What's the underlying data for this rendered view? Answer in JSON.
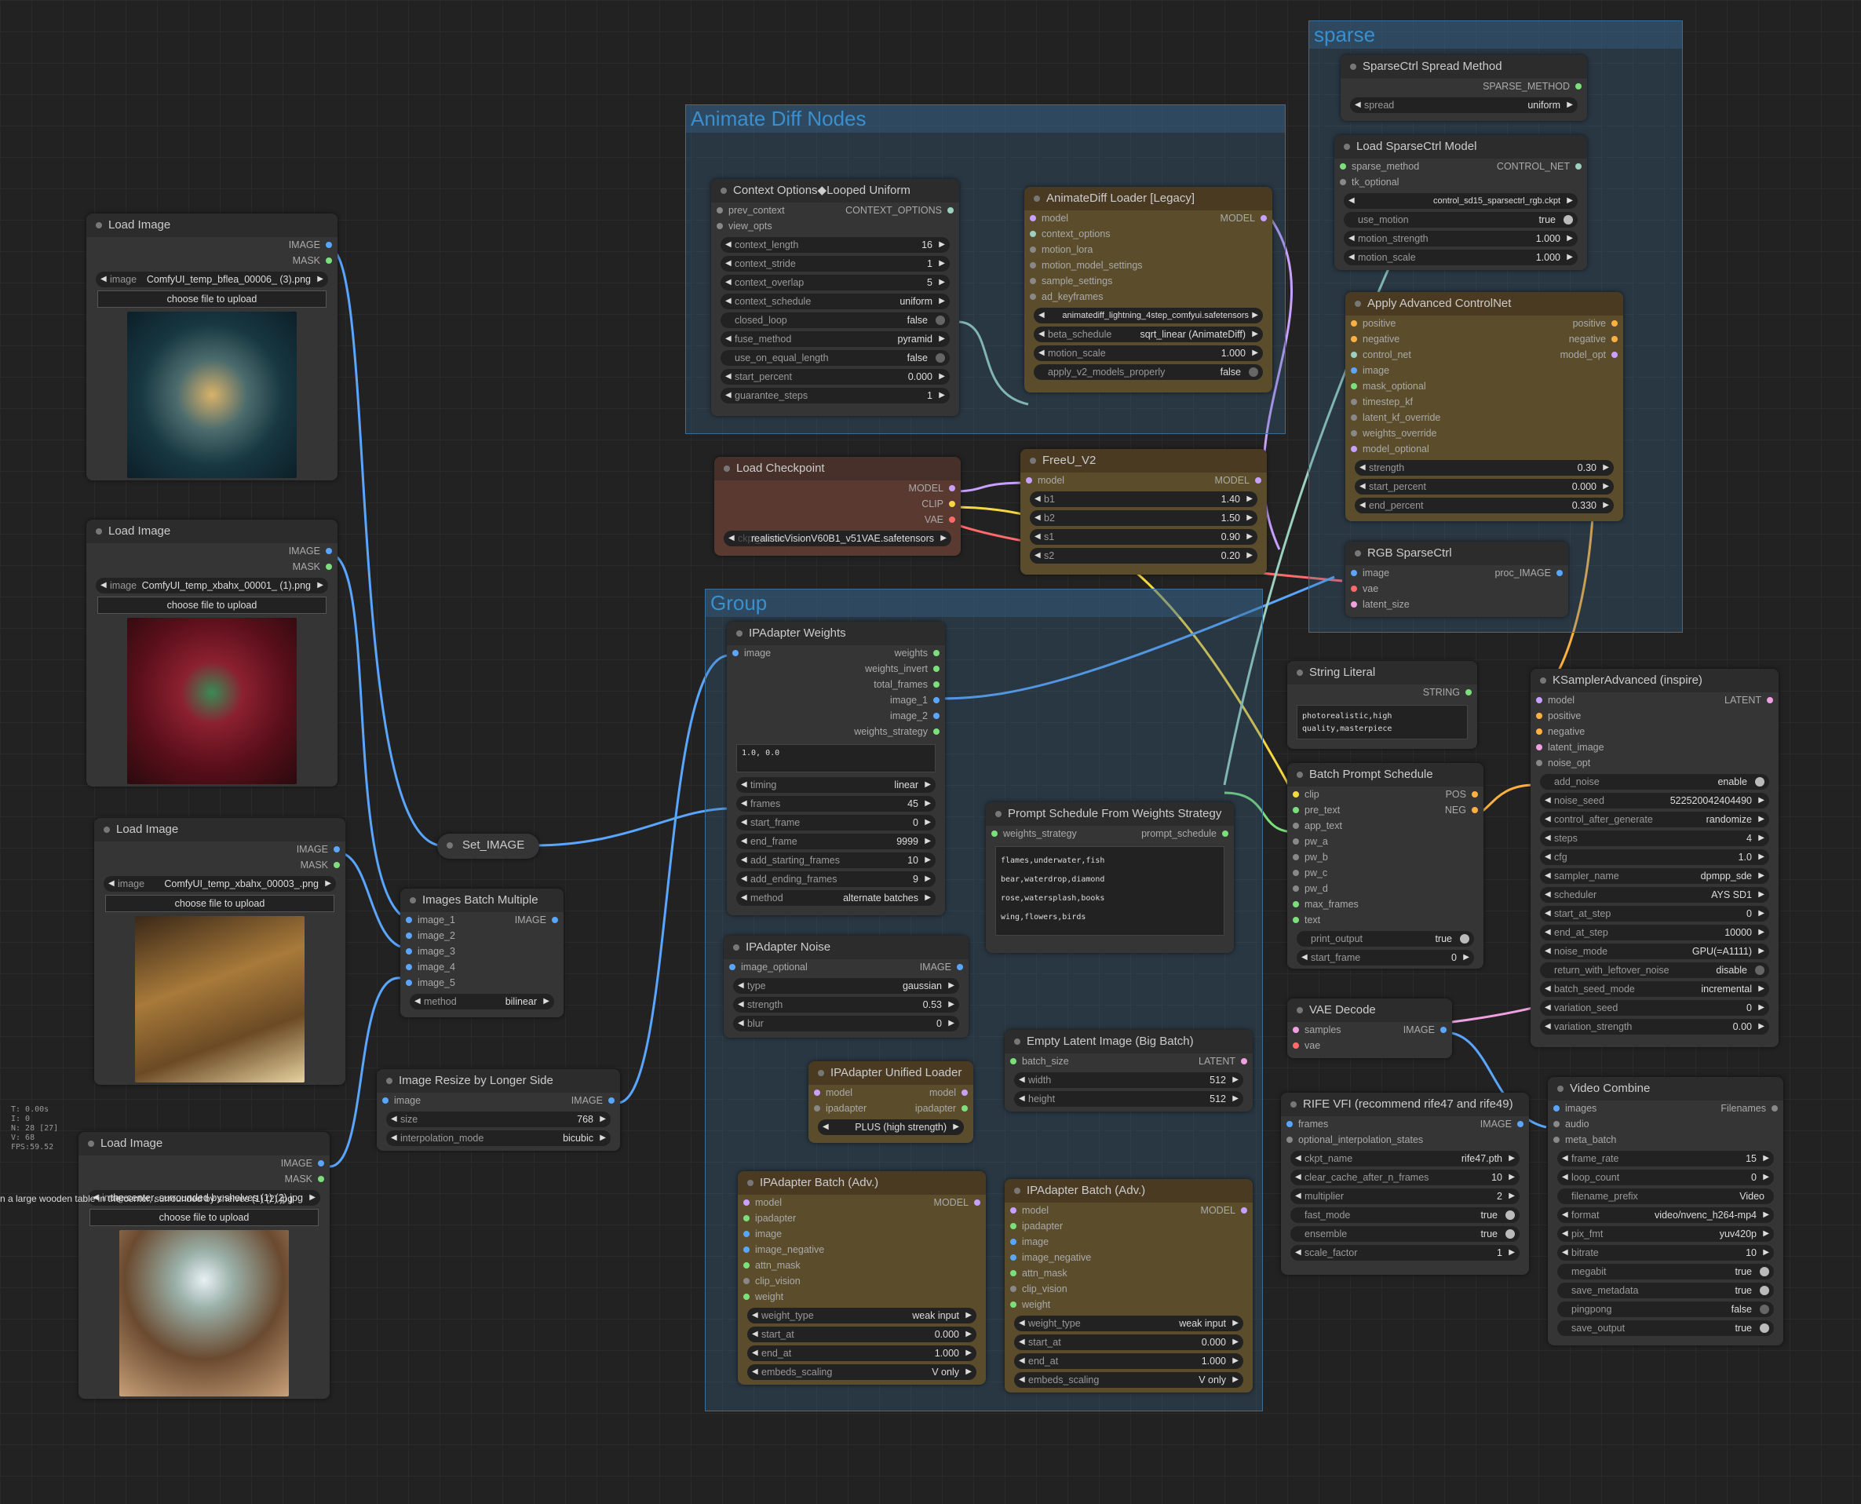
{
  "groups": {
    "animate": "Animate Diff Nodes",
    "sparse": "sparse",
    "group": "Group"
  },
  "stats": {
    "t": "T: 0.00s",
    "i": "I: 0",
    "n": "N: 28 [27]",
    "v": "V: 68",
    "fps": "FPS:59.52"
  },
  "stray_text": "n a large wooden table in the center, surrounded by shelves (1) (2).jpg",
  "load1": {
    "title": "Load Image",
    "out1": "IMAGE",
    "out2": "MASK",
    "image_label": "image",
    "image": "ComfyUI_temp_bflea_00006_ (3).png",
    "upload": "choose file to upload"
  },
  "load2": {
    "title": "Load Image",
    "out1": "IMAGE",
    "out2": "MASK",
    "image_label": "image",
    "image": "ComfyUI_temp_xbahx_00001_ (1).png",
    "upload": "choose file to upload"
  },
  "load3": {
    "title": "Load Image",
    "out1": "IMAGE",
    "out2": "MASK",
    "image_label": "image",
    "image": "ComfyUI_temp_xbahx_00003_.png",
    "upload": "choose file to upload"
  },
  "load4": {
    "title": "Load Image",
    "out1": "IMAGE",
    "out2": "MASK",
    "image_label": "image",
    "image": "the center, surrounded by shelves (1) (2).jpg",
    "upload": "choose file to upload"
  },
  "setimage": {
    "title": "Set_IMAGE"
  },
  "batchmult": {
    "title": "Images Batch Multiple",
    "in": [
      "image_1",
      "image_2",
      "image_3",
      "image_4",
      "image_5"
    ],
    "out": "IMAGE",
    "method_label": "method",
    "method": "bilinear"
  },
  "resize": {
    "title": "Image Resize by Longer Side",
    "in": "image",
    "out": "IMAGE",
    "size_label": "size",
    "size": "768",
    "interp_label": "interpolation_mode",
    "interp": "bicubic"
  },
  "ctxopts": {
    "title": "Context Options◆Looped Uniform",
    "in": [
      "prev_context",
      "view_opts"
    ],
    "out": "CONTEXT_OPTIONS",
    "widgets": [
      [
        "context_length",
        "16"
      ],
      [
        "context_stride",
        "1"
      ],
      [
        "context_overlap",
        "5"
      ],
      [
        "context_schedule",
        "uniform"
      ],
      [
        "closed_loop",
        "false"
      ],
      [
        "fuse_method",
        "pyramid"
      ],
      [
        "use_on_equal_length",
        "false"
      ],
      [
        "start_percent",
        "0.000"
      ],
      [
        "guarantee_steps",
        "1"
      ]
    ]
  },
  "adloader": {
    "title": "AnimateDiff Loader [Legacy]",
    "in": [
      "model",
      "context_options",
      "motion_lora",
      "motion_model_settings",
      "sample_settings",
      "ad_keyframes"
    ],
    "out": "MODEL",
    "model_name": "animatediff_lightning_4step_comfyui.safetensors",
    "widgets": [
      [
        "beta_schedule",
        "sqrt_linear (AnimateDiff)"
      ],
      [
        "motion_scale",
        "1.000"
      ],
      [
        "apply_v2_models_properly",
        "false"
      ]
    ]
  },
  "ckpt": {
    "title": "Load Checkpoint",
    "out": [
      "MODEL",
      "CLIP",
      "VAE"
    ],
    "ckpt_label": "ckpt_name",
    "ckpt": "realisticVisionV60B1_v51VAE.safetensors"
  },
  "freeu": {
    "title": "FreeU_V2",
    "in": "model",
    "out": "MODEL",
    "widgets": [
      [
        "b1",
        "1.40"
      ],
      [
        "b2",
        "1.50"
      ],
      [
        "s1",
        "0.90"
      ],
      [
        "s2",
        "0.20"
      ]
    ]
  },
  "sc_spread": {
    "title": "SparseCtrl Spread Method",
    "out": "SPARSE_METHOD",
    "spread_label": "spread",
    "spread": "uniform"
  },
  "sc_load": {
    "title": "Load SparseCtrl Model",
    "in": [
      "sparse_method",
      "tk_optional"
    ],
    "out": "CONTROL_NET",
    "model": "control_sd15_sparsectrl_rgb.ckpt",
    "widgets": [
      [
        "use_motion",
        "true"
      ],
      [
        "motion_strength",
        "1.000"
      ],
      [
        "motion_scale",
        "1.000"
      ]
    ]
  },
  "acn": {
    "title": "Apply Advanced ControlNet",
    "in": [
      "positive",
      "negative",
      "control_net",
      "image",
      "mask_optional",
      "timestep_kf",
      "latent_kf_override",
      "weights_override",
      "model_optional"
    ],
    "out": [
      "positive",
      "negative",
      "model_opt"
    ],
    "widgets": [
      [
        "strength",
        "0.30"
      ],
      [
        "start_percent",
        "0.000"
      ],
      [
        "end_percent",
        "0.330"
      ]
    ]
  },
  "rgbsc": {
    "title": "RGB SparseCtrl",
    "in": [
      "image",
      "vae",
      "latent_size"
    ],
    "out": "proc_IMAGE"
  },
  "ipw": {
    "title": "IPAdapter Weights",
    "in": "image",
    "out": [
      "weights",
      "weights_invert",
      "total_frames",
      "image_1",
      "image_2",
      "weights_strategy"
    ],
    "text": "1.0, 0.0",
    "widgets": [
      [
        "timing",
        "linear"
      ],
      [
        "frames",
        "45"
      ],
      [
        "start_frame",
        "0"
      ],
      [
        "end_frame",
        "9999"
      ],
      [
        "add_starting_frames",
        "10"
      ],
      [
        "add_ending_frames",
        "9"
      ],
      [
        "method",
        "alternate batches"
      ]
    ]
  },
  "ipnoise": {
    "title": "IPAdapter Noise",
    "in": "image_optional",
    "out": "IMAGE",
    "widgets": [
      [
        "type",
        "gaussian"
      ],
      [
        "strength",
        "0.53"
      ],
      [
        "blur",
        "0"
      ]
    ]
  },
  "ipunified": {
    "title": "IPAdapter Unified Loader",
    "in": [
      "model",
      "ipadapter"
    ],
    "out": [
      "model",
      "ipadapter"
    ],
    "preset": "PLUS (high strength)"
  },
  "ipbatch1": {
    "title": "IPAdapter Batch (Adv.)",
    "in": [
      "model",
      "ipadapter",
      "image",
      "image_negative",
      "attn_mask",
      "clip_vision",
      "weight"
    ],
    "out": "MODEL",
    "widgets": [
      [
        "weight_type",
        "weak input"
      ],
      [
        "start_at",
        "0.000"
      ],
      [
        "end_at",
        "1.000"
      ],
      [
        "embeds_scaling",
        "V only"
      ]
    ]
  },
  "ipbatch2": {
    "title": "IPAdapter Batch (Adv.)",
    "in": [
      "model",
      "ipadapter",
      "image",
      "image_negative",
      "attn_mask",
      "clip_vision",
      "weight"
    ],
    "out": "MODEL",
    "widgets": [
      [
        "weight_type",
        "weak input"
      ],
      [
        "start_at",
        "0.000"
      ],
      [
        "end_at",
        "1.000"
      ],
      [
        "embeds_scaling",
        "V only"
      ]
    ]
  },
  "psfw": {
    "title": "Prompt Schedule From Weights Strategy",
    "in": "weights_strategy",
    "out": "prompt_schedule",
    "text": "flames,underwater,fish\nbear,waterdrop,diamond\nrose,watersplash,books\nwing,flowers,birds"
  },
  "emptylatent": {
    "title": "Empty Latent Image (Big Batch)",
    "in": "batch_size",
    "out": "LATENT",
    "widgets": [
      [
        "width",
        "512"
      ],
      [
        "height",
        "512"
      ]
    ]
  },
  "strlit": {
    "title": "String Literal",
    "out": "STRING",
    "text": "photorealistic,high quality,masterpiece"
  },
  "bps": {
    "title": "Batch Prompt Schedule",
    "in": [
      "clip",
      "pre_text",
      "app_text",
      "pw_a",
      "pw_b",
      "pw_c",
      "pw_d",
      "max_frames",
      "text"
    ],
    "out": [
      "POS",
      "NEG"
    ],
    "widgets": [
      [
        "print_output",
        "true"
      ],
      [
        "start_frame",
        "0"
      ]
    ]
  },
  "vaedec": {
    "title": "VAE Decode",
    "in": [
      "samples",
      "vae"
    ],
    "out": "IMAGE"
  },
  "rife": {
    "title": "RIFE VFI (recommend rife47 and rife49)",
    "in": [
      "frames",
      "optional_interpolation_states"
    ],
    "out": "IMAGE",
    "widgets": [
      [
        "ckpt_name",
        "rife47.pth"
      ],
      [
        "clear_cache_after_n_frames",
        "10"
      ],
      [
        "multiplier",
        "2"
      ],
      [
        "fast_mode",
        "true"
      ],
      [
        "ensemble",
        "true"
      ],
      [
        "scale_factor",
        "1"
      ]
    ]
  },
  "ksampler": {
    "title": "KSamplerAdvanced (inspire)",
    "in": [
      "model",
      "positive",
      "negative",
      "latent_image",
      "noise_opt"
    ],
    "out": "LATENT",
    "widgets": [
      [
        "add_noise",
        "enable"
      ],
      [
        "noise_seed",
        "522520042404490"
      ],
      [
        "control_after_generate",
        "randomize"
      ],
      [
        "steps",
        "4"
      ],
      [
        "cfg",
        "1.0"
      ],
      [
        "sampler_name",
        "dpmpp_sde"
      ],
      [
        "scheduler",
        "AYS SD1"
      ],
      [
        "start_at_step",
        "0"
      ],
      [
        "end_at_step",
        "10000"
      ],
      [
        "noise_mode",
        "GPU(=A1111)"
      ],
      [
        "return_with_leftover_noise",
        "disable"
      ],
      [
        "batch_seed_mode",
        "incremental"
      ],
      [
        "variation_seed",
        "0"
      ],
      [
        "variation_strength",
        "0.00"
      ]
    ]
  },
  "vcombine": {
    "title": "Video Combine",
    "in": [
      "images",
      "audio",
      "meta_batch"
    ],
    "out": "Filenames",
    "widgets": [
      [
        "frame_rate",
        "15"
      ],
      [
        "loop_count",
        "0"
      ],
      [
        "filename_prefix",
        "Video"
      ],
      [
        "format",
        "video/nvenc_h264-mp4"
      ],
      [
        "pix_fmt",
        "yuv420p"
      ],
      [
        "bitrate",
        "10"
      ],
      [
        "megabit",
        "true"
      ],
      [
        "save_metadata",
        "true"
      ],
      [
        "pingpong",
        "false"
      ],
      [
        "save_output",
        "true"
      ]
    ]
  }
}
